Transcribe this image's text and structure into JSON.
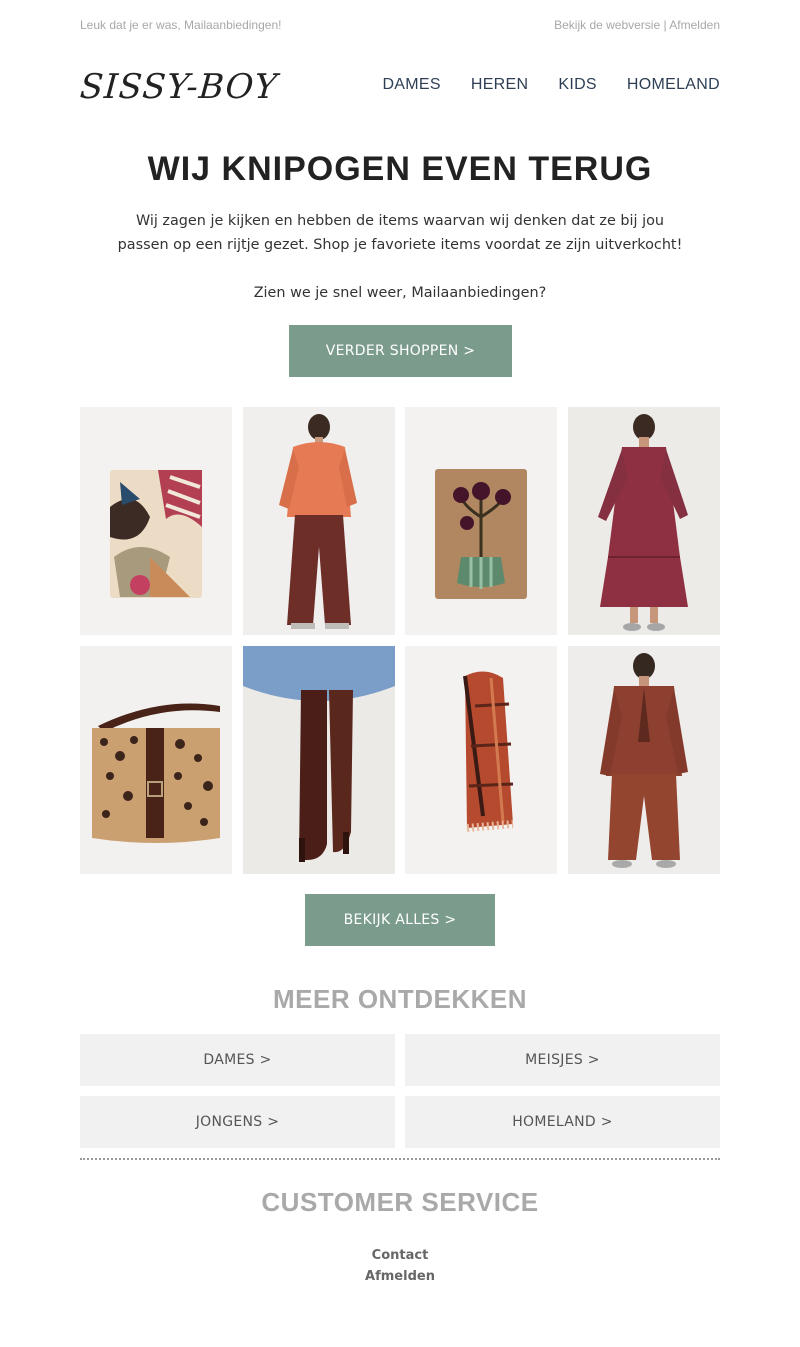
{
  "topbar": {
    "greeting": "Leuk dat je er was, Mailaanbiedingen!",
    "webversion": "Bekijk de webversie",
    "separator": "|",
    "unsubscribe": "Afmelden"
  },
  "logo": {
    "text": "SISSY-BOY"
  },
  "nav": {
    "items": [
      {
        "label": "DAMES"
      },
      {
        "label": "HEREN"
      },
      {
        "label": "KIDS"
      },
      {
        "label": "HOMELAND"
      }
    ]
  },
  "hero": {
    "title": "WIJ KNIPOGEN EVEN TERUG",
    "line1": "Wij zagen je kijken en hebben de items waarvan wij denken dat ze bij jou",
    "line2": "passen op een rijtje gezet. Shop je favoriete items voordat ze zijn uitverkocht!",
    "greeting": "Zien we je snel weer, Mailaanbiedingen?",
    "cta": "VERDER SHOPPEN >"
  },
  "products": [
    {
      "icon": "patterned-rug-image"
    },
    {
      "icon": "orange-blouse-outfit-image"
    },
    {
      "icon": "flower-vase-rug-image"
    },
    {
      "icon": "red-maxi-dress-image"
    },
    {
      "icon": "leopard-bag-image"
    },
    {
      "icon": "brown-suede-boots-image"
    },
    {
      "icon": "rust-check-scarf-image"
    },
    {
      "icon": "brown-suit-image"
    }
  ],
  "view_all": "BEKIJK ALLES >",
  "discover": {
    "title": "MEER ONTDEKKEN",
    "items": [
      {
        "label": "DAMES >"
      },
      {
        "label": "MEISJES >"
      },
      {
        "label": "JONGENS >"
      },
      {
        "label": "HOMELAND >"
      }
    ]
  },
  "customer_service": {
    "title": "CUSTOMER SERVICE",
    "contact": "Contact",
    "unsubscribe": "Afmelden"
  },
  "colors": {
    "button": "#7b9c8d",
    "nav": "#2e3f55",
    "category_bg": "#f1f1f1"
  }
}
